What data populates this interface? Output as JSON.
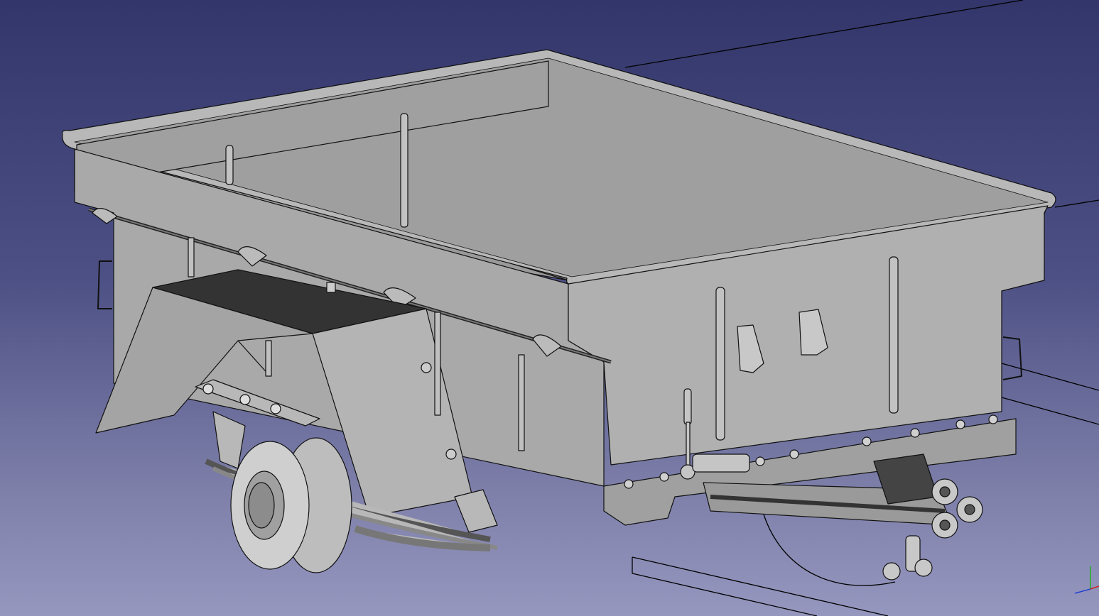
{
  "view": {
    "background_top": "#33366a",
    "background_bottom": "#9697bf",
    "model_fill": "#a8a8a8",
    "model_shade": "#8a8a8a",
    "model_dark": "#3a3a3a",
    "edge_color": "#111111"
  },
  "axes": {
    "x_color": "#d02020",
    "y_color": "#20b020",
    "z_color": "#2040d0"
  }
}
